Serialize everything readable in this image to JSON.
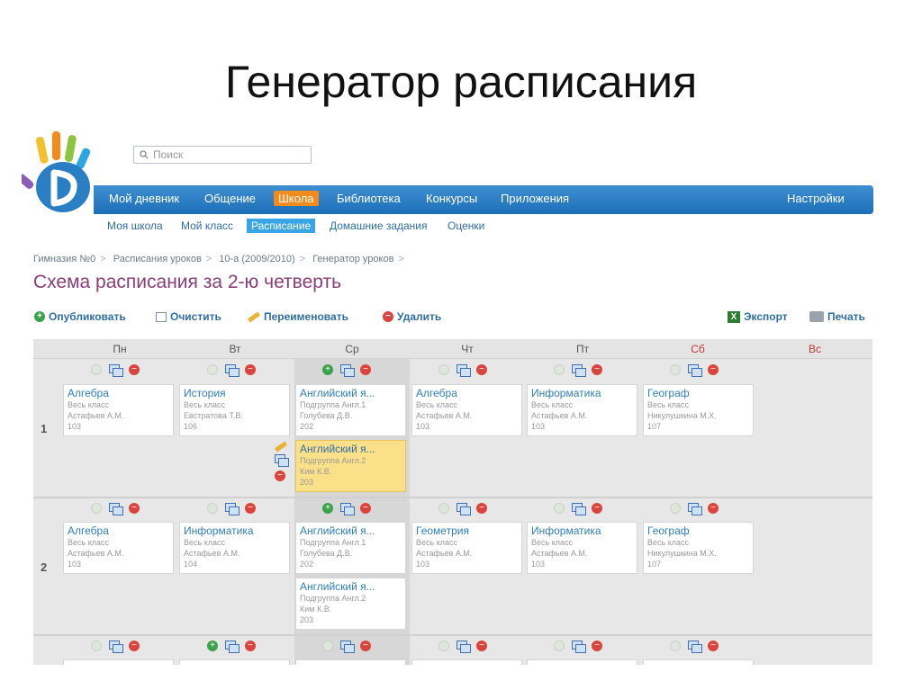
{
  "slide": {
    "title": "Генератор расписания"
  },
  "search": {
    "placeholder": "Поиск"
  },
  "nav": {
    "items": [
      "Мой дневник",
      "Общение",
      "Школа",
      "Библиотека",
      "Конкурсы",
      "Приложения"
    ],
    "active_index": 2,
    "settings": "Настройки"
  },
  "subnav": {
    "items": [
      "Моя школа",
      "Мой класс",
      "Расписание",
      "Домашние задания",
      "Оценки"
    ],
    "active_index": 2
  },
  "breadcrumb": [
    "Гимназия №0",
    "Расписания уроков",
    "10-а (2009/2010)",
    "Генератор уроков"
  ],
  "page": {
    "heading": "Схема расписания за 2-ю четверть"
  },
  "toolbar": {
    "publish": "Опубликовать",
    "clear": "Очистить",
    "rename": "Переименовать",
    "delete": "Удалить",
    "export": "Экспорт",
    "print": "Печать"
  },
  "days": [
    "Пн",
    "Вт",
    "Ср",
    "Чт",
    "Пт",
    "Сб",
    "Вс"
  ],
  "rows": [
    {
      "number": "1",
      "cards": [
        {
          "subject": "Алгебра",
          "group": "Весь класс",
          "teacher": "Астафьев А.М.",
          "room": "103"
        },
        {
          "subject": "История",
          "group": "Весь класс",
          "teacher": "Евстратова Т.В.",
          "room": "106"
        },
        {
          "subject": "Английский я...",
          "group": "Подгруппа Англ.1",
          "teacher": "Голубева Д.В.",
          "room": "202"
        },
        {
          "subject": "Алгебра",
          "group": "Весь класс",
          "teacher": "Астафьев А.М.",
          "room": "103"
        },
        {
          "subject": "Информатика",
          "group": "Весь класс",
          "teacher": "Астафьев А.М.",
          "room": "103"
        },
        {
          "subject": "Географ",
          "group": "Весь класс",
          "teacher": "Никулушкина М.Х.",
          "room": "107"
        }
      ],
      "extra": {
        "subject": "Английский я...",
        "group": "Подгруппа Англ.2",
        "teacher": "Ким К.В.",
        "room": "203"
      }
    },
    {
      "number": "2",
      "cards": [
        {
          "subject": "Алгебра",
          "group": "Весь класс",
          "teacher": "Астафьев А.М.",
          "room": "103"
        },
        {
          "subject": "Информатика",
          "group": "Весь класс",
          "teacher": "Астафьев А.М.",
          "room": "104"
        },
        {
          "subject": "Английский я...",
          "group": "Подгруппа Англ.1",
          "teacher": "Голубева Д.В.",
          "room": "202"
        },
        {
          "subject": "Геометрия",
          "group": "Весь класс",
          "teacher": "Астафьев А.М.",
          "room": "103"
        },
        {
          "subject": "Информатика",
          "group": "Весь класс",
          "teacher": "Астафьев А.М.",
          "room": "103"
        },
        {
          "subject": "Географ",
          "group": "Весь класс",
          "teacher": "Никулушкина М.Х.",
          "room": "107"
        }
      ],
      "extra": {
        "subject": "Английский я...",
        "group": "Подгруппа Англ.2",
        "teacher": "Ким К.В.",
        "room": "203"
      }
    }
  ],
  "colors": {
    "nav": "#1c6fb8",
    "active_tab": "#f28b1b",
    "heading": "#8a3e78",
    "link": "#2f6ea6",
    "selected_card": "#fbe08a"
  }
}
